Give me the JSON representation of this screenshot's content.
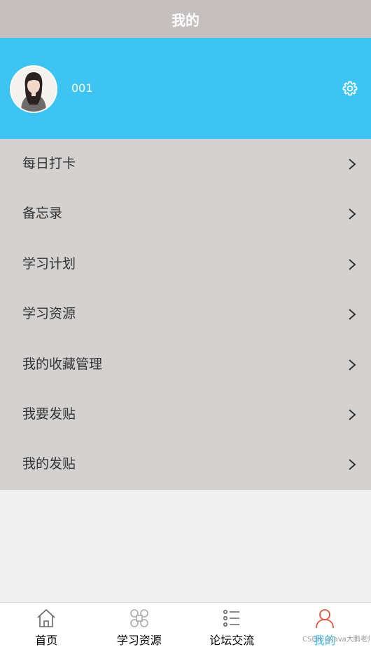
{
  "header": {
    "title": "我的"
  },
  "profile": {
    "avatar_icon": "user-avatar-photo",
    "username": "001",
    "settings_icon": "gear-icon",
    "background_color": "#3ec4f3"
  },
  "menu": {
    "items": [
      {
        "label": "每日打卡"
      },
      {
        "label": "备忘录"
      },
      {
        "label": "学习计划"
      },
      {
        "label": "学习资源"
      },
      {
        "label": "我的收藏管理"
      },
      {
        "label": "我要发贴"
      },
      {
        "label": "我的发贴"
      }
    ]
  },
  "tabbar": {
    "tabs": [
      {
        "label": "首页",
        "icon": "home-icon"
      },
      {
        "label": "学习资源",
        "icon": "command-icon"
      },
      {
        "label": "论坛交流",
        "icon": "list-icon"
      },
      {
        "label": "我的",
        "icon": "user-icon",
        "active": true
      }
    ],
    "active_color": "#3ec4f3"
  },
  "watermark": {
    "text": "CSDN @Java大鹏老师"
  }
}
